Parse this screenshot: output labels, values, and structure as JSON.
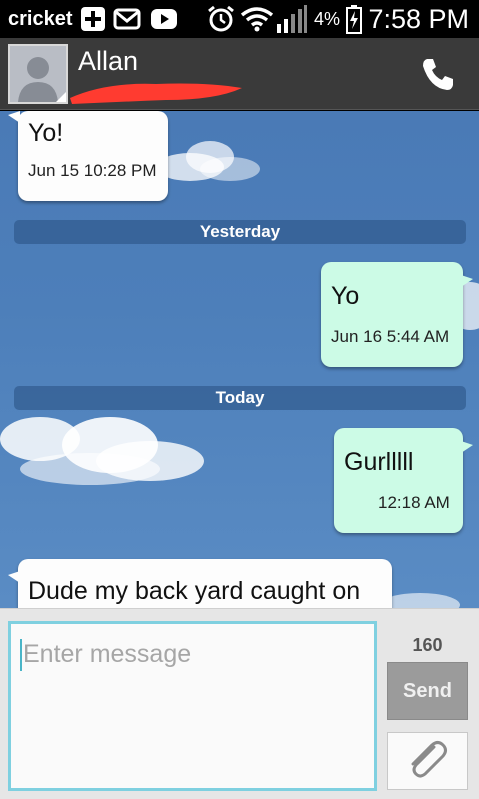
{
  "status_bar": {
    "carrier": "cricket",
    "battery_percent": "4%",
    "time": "7:58 PM",
    "icons": [
      "add-icon",
      "mail-icon",
      "youtube-icon",
      "alarm-icon",
      "wifi-icon",
      "signal-icon",
      "battery-charging-icon"
    ]
  },
  "header": {
    "contact_name": "Allan",
    "icons": [
      "avatar-placeholder-icon",
      "phone-icon"
    ]
  },
  "messages": [
    {
      "direction": "in",
      "text": "Yo!",
      "time": "Jun 15 10:28 PM"
    },
    {
      "direction": "divider",
      "text": "Yesterday"
    },
    {
      "direction": "out",
      "text": "Yo",
      "time": "Jun 16 5:44 AM"
    },
    {
      "direction": "divider",
      "text": "Today"
    },
    {
      "direction": "out",
      "text": "Gurlllll",
      "time": "12:18 AM"
    },
    {
      "direction": "in",
      "text": "Dude my back yard caught on"
    }
  ],
  "compose": {
    "placeholder": "Enter message",
    "char_count": "160",
    "send_label": "Send",
    "icons": [
      "paperclip-icon"
    ]
  },
  "colors": {
    "incoming_bubble": "#fdfdfd",
    "outgoing_bubble": "#ccfbe6",
    "input_border": "#7fd0e0",
    "send_button": "#9b9b9b",
    "redaction": "#ff3b30"
  }
}
